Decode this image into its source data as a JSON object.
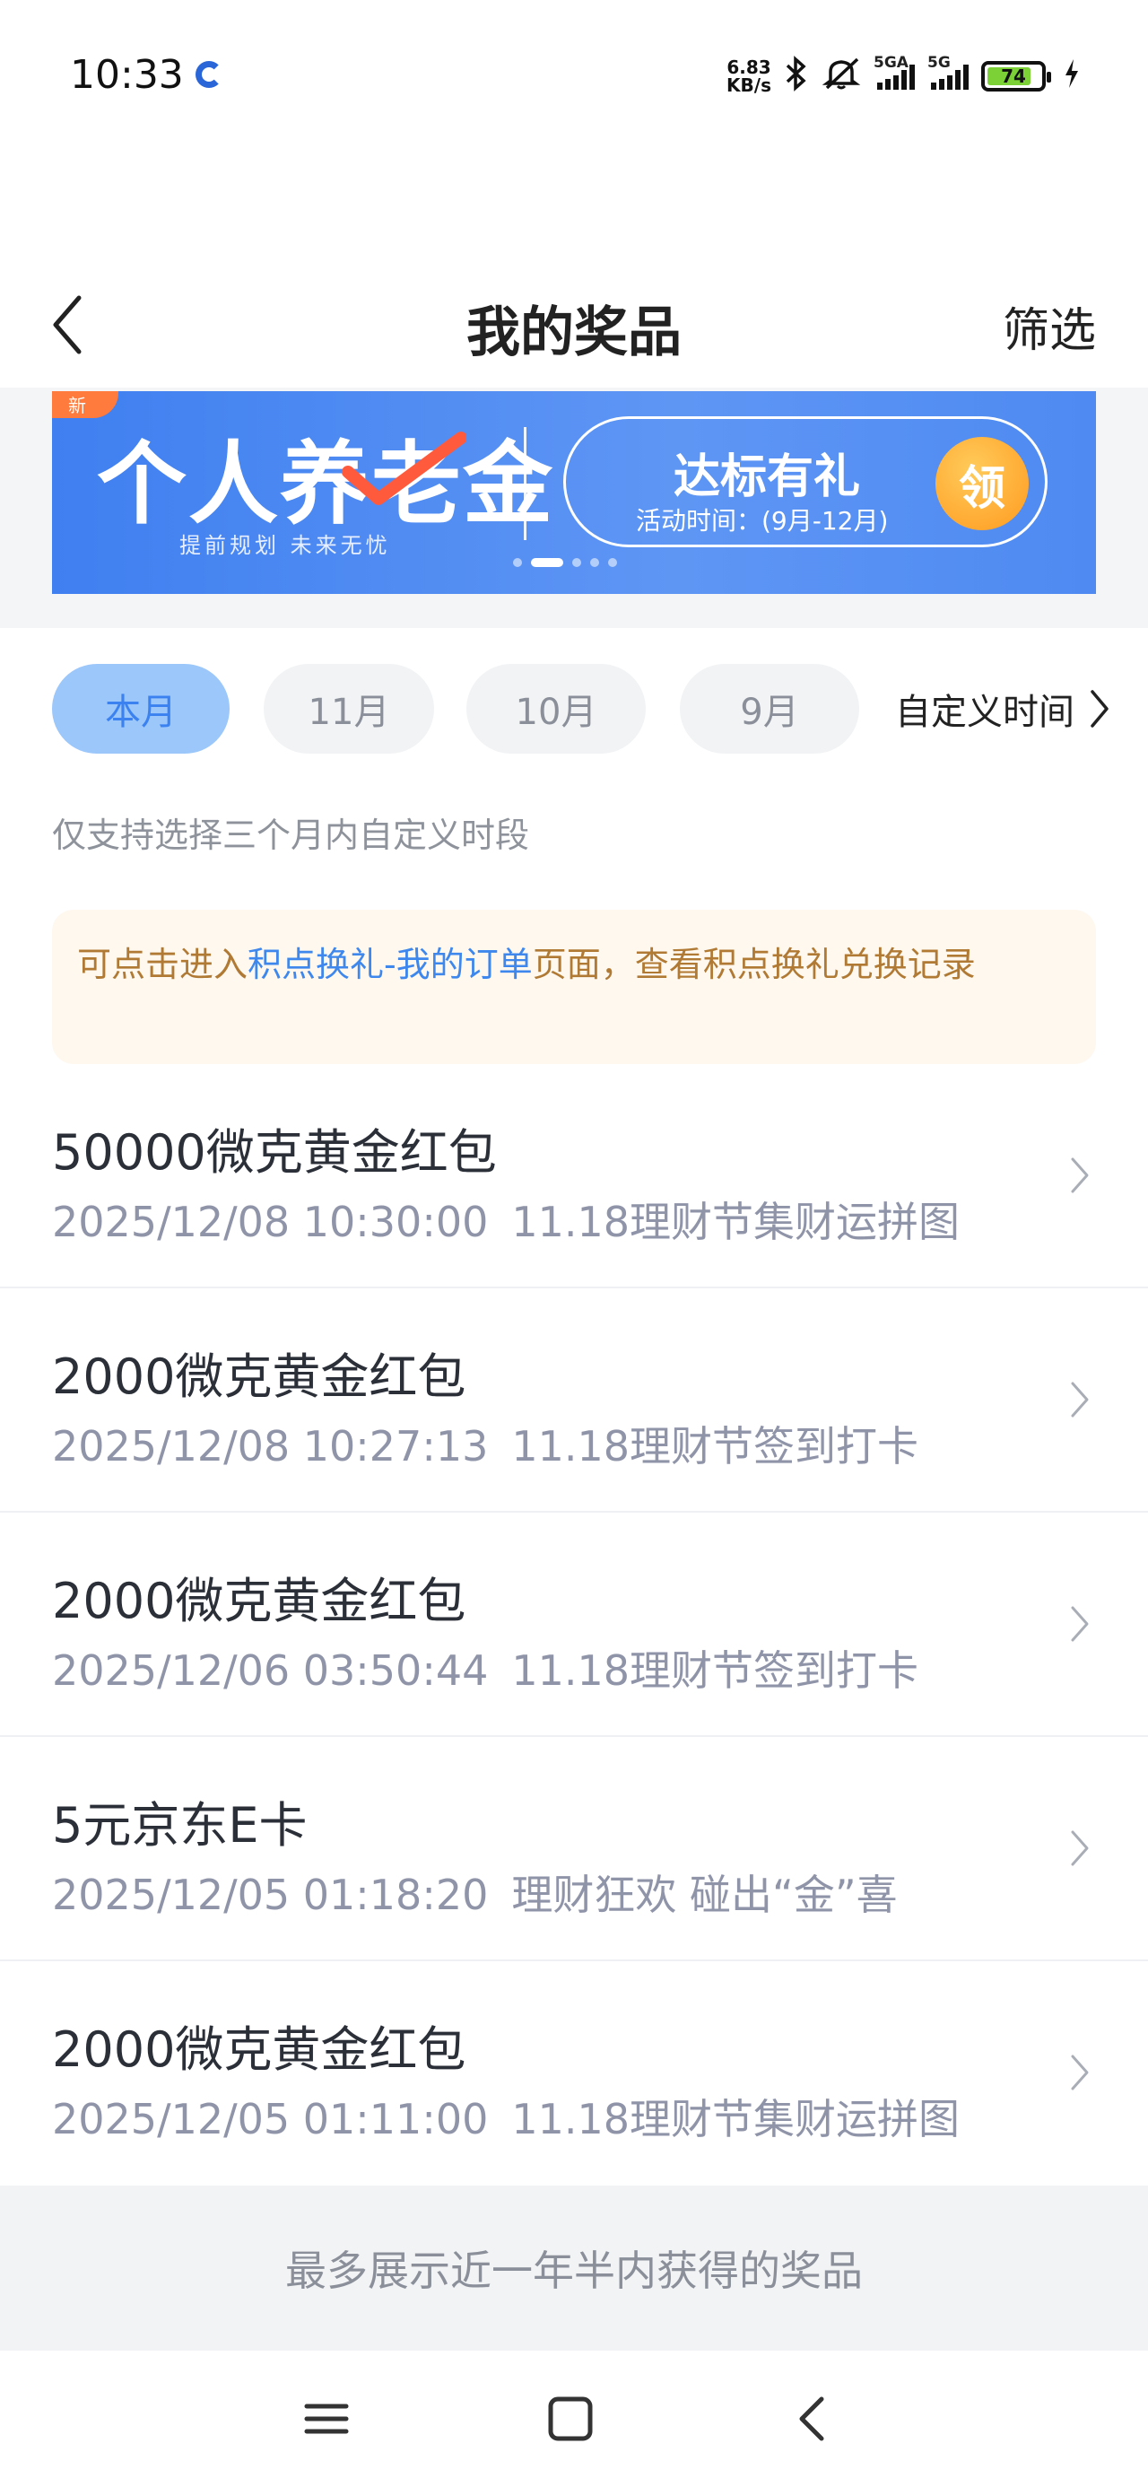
{
  "status_bar": {
    "time": "10:33",
    "net_speed_value": "6.83",
    "net_speed_unit": "KB/s",
    "signal1_label": "5GA",
    "signal2_label": "5G",
    "battery": "74",
    "icons": [
      "app-icon",
      "bluetooth-icon",
      "mute-icon",
      "signal-icon",
      "battery-icon",
      "charging-icon"
    ]
  },
  "header": {
    "title": "我的奖品",
    "filter_label": "筛选"
  },
  "banner": {
    "badge": "新",
    "title": "个人养老金",
    "subtitle": "提前规划  未来无忧",
    "pill_title": "达标有礼",
    "pill_date": "活动时间：(9月-12月)",
    "button": "领"
  },
  "tabs": {
    "items": [
      "本月",
      "11月",
      "10月",
      "9月"
    ],
    "active_index": 0,
    "custom": "自定义时间"
  },
  "hint": "仅支持选择三个月内自定义时段",
  "notice": {
    "prefix": "可点击进入",
    "link": "积点换礼-我的订单",
    "suffix": "页面，查看积点换礼兑换记录"
  },
  "prizes": [
    {
      "title": "50000微克黄金红包",
      "datetime": "2025/12/08 10:30:00",
      "source": "11.18理财节集财运拼图"
    },
    {
      "title": "2000微克黄金红包",
      "datetime": "2025/12/08 10:27:13",
      "source": "11.18理财节签到打卡"
    },
    {
      "title": "2000微克黄金红包",
      "datetime": "2025/12/06 03:50:44",
      "source": "11.18理财节签到打卡"
    },
    {
      "title": "5元京东E卡",
      "datetime": "2025/12/05 01:18:20",
      "source": "理财狂欢 碰出“金”喜"
    },
    {
      "title": "2000微克黄金红包",
      "datetime": "2025/12/05 01:11:00",
      "source": "11.18理财节集财运拼图"
    }
  ],
  "footer_note": "最多展示近一年半内获得的奖品",
  "colors": {
    "accent": "#3b82f0",
    "tab_active_bg": "#9cc7fb",
    "notice_text": "#b07a34",
    "notice_bg": "#fff8ef"
  }
}
